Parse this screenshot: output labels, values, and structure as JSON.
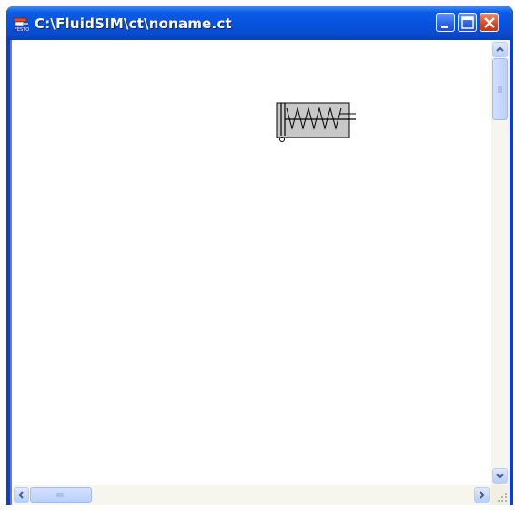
{
  "window": {
    "title": "C:\\FluidSIM\\ct\\noname.ct",
    "app_icon": "fluidsim-icon",
    "controls": [
      "minimize-icon",
      "maximize-icon",
      "close-icon"
    ]
  },
  "canvas": {
    "component": "cylinder-with-spring-symbol"
  },
  "colors": {
    "titlebar": "#0a54e3",
    "close_button": "#d9451f",
    "scrollbar_track": "#f6f5ee",
    "symbol_fill": "#c8c8c8"
  }
}
